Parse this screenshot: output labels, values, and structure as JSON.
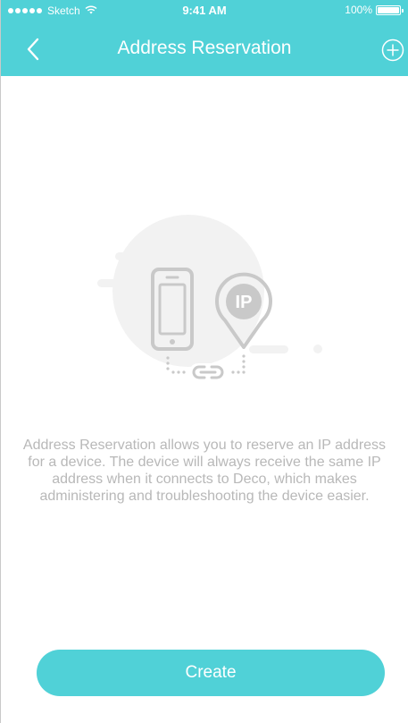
{
  "status_bar": {
    "carrier": "Sketch",
    "time": "9:41 AM",
    "battery": "100%"
  },
  "nav": {
    "title": "Address Reservation",
    "back_icon": "chevron-left-icon",
    "add_icon": "circle-plus-icon"
  },
  "illustration": {
    "badge_text": "IP",
    "icons": [
      "phone-icon",
      "location-pin-icon",
      "link-icon"
    ]
  },
  "description": "Address Reservation allows you to reserve an IP address for a device. The device will always receive the same IP address when it connects to Deco, which makes administering and troubleshooting the device easier.",
  "actions": {
    "create_label": "Create"
  },
  "colors": {
    "accent": "#50d1d7",
    "text_muted": "#b8b8b8",
    "illustration_bg": "#f2f2f2",
    "illustration_fg": "#c9c9c9"
  }
}
